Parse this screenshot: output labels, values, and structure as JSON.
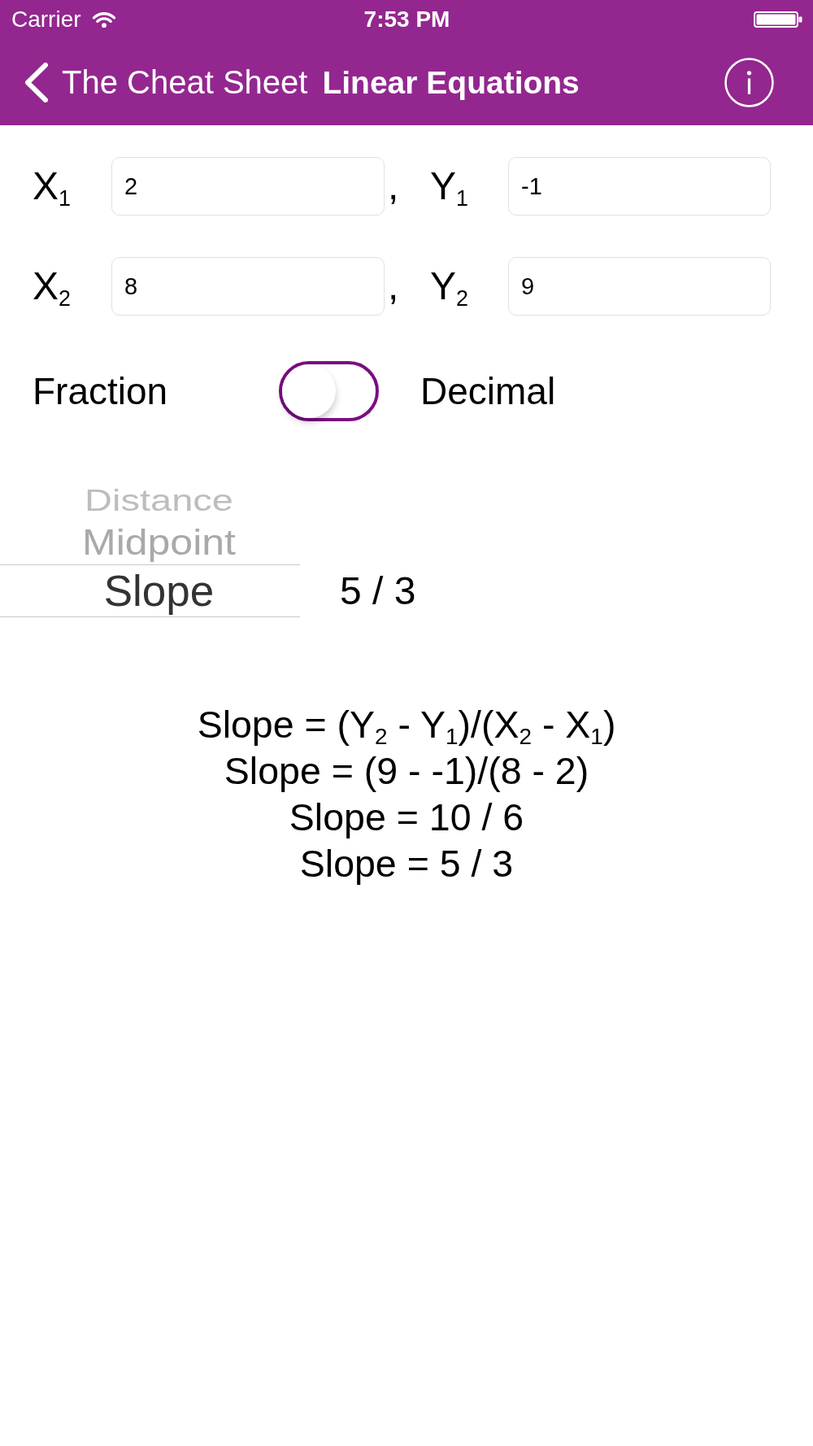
{
  "status_bar": {
    "carrier": "Carrier",
    "time": "7:53 PM"
  },
  "nav_bar": {
    "back_label": "The Cheat Sheet",
    "title": "Linear Equations"
  },
  "points": [
    {
      "fields": [
        {
          "label": "X$_{1}$",
          "value": "2"
        },
        {
          "label": "Y$_{1}$",
          "value": "-1"
        }
      ],
      "separator": ","
    },
    {
      "fields": [
        {
          "label": "X$_{2}$",
          "value": "8"
        },
        {
          "label": "Y$_{2}$",
          "value": "9"
        }
      ],
      "separator": ","
    }
  ],
  "format_toggle": {
    "off_label": "Fraction",
    "on_label": "Decimal",
    "on": false
  },
  "picker": {
    "items": [
      {
        "label": "Distance",
        "selected": false
      },
      {
        "label": "Midpoint",
        "selected": false
      },
      {
        "label": "Slope",
        "selected": true
      }
    ],
    "result": "5 / 3"
  },
  "formula_lines": [
    "Slope = (Y$_{2}$ - Y$_{1}$)/(X$_{2}$ - X$_{1}$)",
    "Slope = (9 - -1)/(8 - 2)",
    "Slope = 10 / 6",
    "Slope = 5 / 3"
  ]
}
